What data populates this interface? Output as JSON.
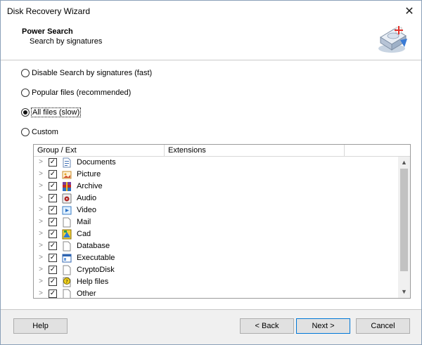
{
  "window": {
    "title": "Disk Recovery Wizard"
  },
  "header": {
    "title": "Power Search",
    "subtitle": "Search by signatures"
  },
  "options": [
    {
      "label": "Disable Search by signatures (fast)",
      "checked": false
    },
    {
      "label": "Popular files (recommended)",
      "checked": false
    },
    {
      "label": "All files (slow)",
      "checked": true
    },
    {
      "label": "Custom",
      "checked": false
    }
  ],
  "tree": {
    "columns": [
      "Group / Ext",
      "Extensions",
      ""
    ],
    "rows": [
      {
        "label": "Documents",
        "icon": "document-icon",
        "checked": true
      },
      {
        "label": "Picture",
        "icon": "picture-icon",
        "checked": true
      },
      {
        "label": "Archive",
        "icon": "archive-icon",
        "checked": true
      },
      {
        "label": "Audio",
        "icon": "audio-icon",
        "checked": true
      },
      {
        "label": "Video",
        "icon": "video-icon",
        "checked": true
      },
      {
        "label": "Mail",
        "icon": "mail-icon",
        "checked": true
      },
      {
        "label": "Cad",
        "icon": "cad-icon",
        "checked": true
      },
      {
        "label": "Database",
        "icon": "database-icon",
        "checked": true
      },
      {
        "label": "Executable",
        "icon": "executable-icon",
        "checked": true
      },
      {
        "label": "CryptoDisk",
        "icon": "cryptodisk-icon",
        "checked": true
      },
      {
        "label": "Help files",
        "icon": "help-files-icon",
        "checked": true
      },
      {
        "label": "Other",
        "icon": "other-icon",
        "checked": true
      }
    ]
  },
  "buttons": {
    "help": "Help",
    "back": "< Back",
    "next": "Next >",
    "cancel": "Cancel"
  }
}
